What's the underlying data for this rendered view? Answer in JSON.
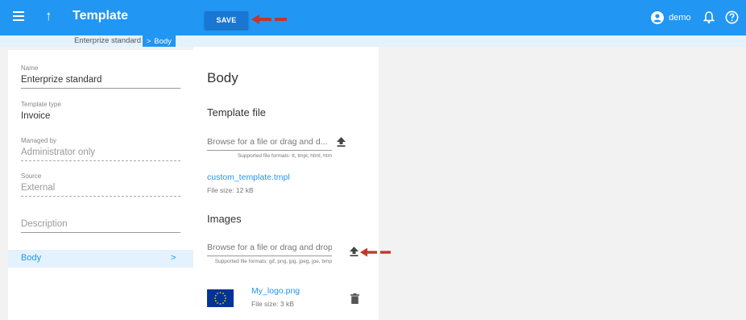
{
  "header": {
    "title": "Template",
    "save_label": "SAVE",
    "user_name": "demo"
  },
  "breadcrumb": {
    "items": [
      "Enterprize standard",
      "Body"
    ]
  },
  "left": {
    "fields": [
      {
        "label": "Name",
        "value": "Enterprize standard"
      },
      {
        "label": "Template type",
        "value": "Invoice"
      },
      {
        "label": "Managed by",
        "value": "Administrator only"
      },
      {
        "label": "Source",
        "value": "External"
      }
    ],
    "description_placeholder": "Description",
    "nav_item": "Body"
  },
  "body": {
    "title": "Body",
    "template_file": {
      "title": "Template file",
      "browse_placeholder": "Browse for a file or drag and d...",
      "hint": "Supported file formats: tt, tmpl, html, htm",
      "file_name": "custom_template.tmpl",
      "file_size": "File size: 12 kB"
    },
    "images": {
      "title": "Images",
      "browse_placeholder": "Browse for a file or drag and drop ...",
      "hint": "Supported file formats: gif, png, jpg, jpeg, jpe, bmp",
      "file_name": "My_logo.png",
      "file_size": "File size: 3 kB"
    }
  },
  "icons": [
    "menu-icon",
    "arrow-up-icon",
    "user-icon",
    "bell-icon",
    "help-icon",
    "upload-icon",
    "trash-icon",
    "chevron-right-icon"
  ],
  "colors": {
    "primary": "#2196f3",
    "save_button": "#1976d2",
    "selected_bg": "#e3f2fd",
    "annotation_arrow": "#c0392b",
    "eu_flag_blue": "#003399",
    "eu_flag_star": "#ffcc00"
  }
}
